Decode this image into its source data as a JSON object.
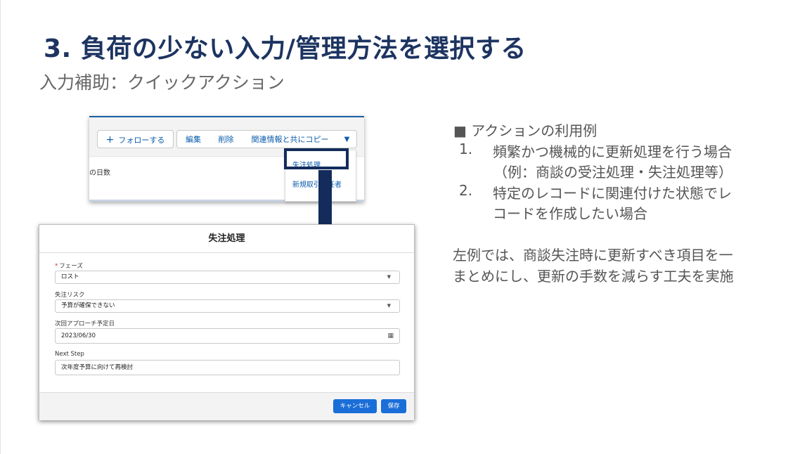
{
  "slide": {
    "title": "3. 負荷の少ない入力/管理方法を選択する",
    "subtitle": "入力補助：クイックアクション"
  },
  "action_bar": {
    "follow_label": "フォローする",
    "edit_label": "編集",
    "delete_label": "削除",
    "copy_label": "関連情報と共にコピー",
    "more_icon": "chevron-down-icon",
    "side_text": "の日数",
    "dropdown_items": [
      "失注処理",
      "新規取引責任者"
    ]
  },
  "modal": {
    "title": "失注処理",
    "fields": [
      {
        "label": "フェーズ",
        "required": true,
        "value": "ロスト",
        "control": "select"
      },
      {
        "label": "失注リスク",
        "required": false,
        "value": "予算が確保できない",
        "control": "select"
      },
      {
        "label": "次回アプローチ予定日",
        "required": false,
        "value": "2023/06/30",
        "control": "date"
      },
      {
        "label": "Next Step",
        "required": false,
        "value": "次年度予算に向けて再検討",
        "control": "text"
      }
    ],
    "required_mark": "*",
    "cancel_label": "キャンセル",
    "save_label": "保存"
  },
  "explanation": {
    "heading": "■ アクションの利用例",
    "items": [
      {
        "num": "1.",
        "lines": [
          "頻繁かつ機械的に更新処理を行う場合",
          "（例：商談の受注処理・失注処理等）"
        ]
      },
      {
        "num": "2.",
        "lines": [
          "特定のレコードに関連付けた状態でレ",
          "コードを作成したい場合"
        ]
      }
    ],
    "note_lines": [
      "左例では、商談失注時に更新すべき項目を一",
      "まとめにし、更新の手数を減らす工夫を実施"
    ]
  },
  "colors": {
    "title": "#1d3461",
    "arrow": "#142c5c",
    "link": "#0b5cab",
    "brand_button": "#1b6ed8"
  }
}
